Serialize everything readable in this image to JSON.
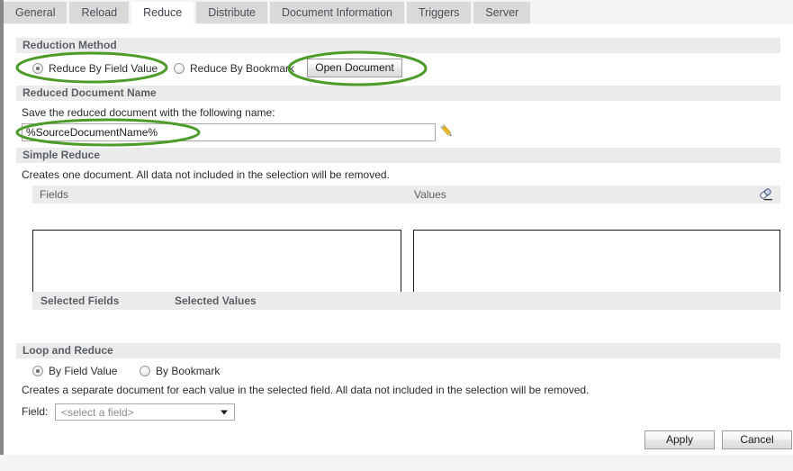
{
  "tabs": [
    {
      "label": "General",
      "active": false
    },
    {
      "label": "Reload",
      "active": false
    },
    {
      "label": "Reduce",
      "active": true
    },
    {
      "label": "Distribute",
      "active": false
    },
    {
      "label": "Document Information",
      "active": false
    },
    {
      "label": "Triggers",
      "active": false
    },
    {
      "label": "Server",
      "active": false
    }
  ],
  "reduction_method": {
    "section_title": "Reduction Method",
    "radio_field_value": "Reduce By Field Value",
    "radio_bookmark": "Reduce By Bookmark",
    "open_document_button": "Open Document"
  },
  "reduced_document_name": {
    "section_title": "Reduced Document Name",
    "description": "Save the reduced document with the following name:",
    "name_value": "%SourceDocumentName%",
    "name_placeholder": "",
    "edit_icon": "pencil-icon"
  },
  "simple_reduce": {
    "section_title": "Simple Reduce",
    "description": "Creates one document. All data not included in the selection will be removed.",
    "fields_header": "Fields",
    "values_header": "Values",
    "clear_icon": "eraser-icon",
    "fields_items": [],
    "values_items": [],
    "selected_fields_header": "Selected Fields",
    "selected_values_header": "Selected Values",
    "selected_rows": []
  },
  "loop_and_reduce": {
    "section_title": "Loop and Reduce",
    "radio_field_value": "By Field Value",
    "radio_bookmark": "By Bookmark",
    "description": "Creates a separate document for each value in the selected field. All data not included in the selection will be removed.",
    "field_label": "Field:",
    "field_select_value": "<select a field>"
  },
  "footer": {
    "apply_button": "Apply",
    "cancel_button": "Cancel"
  },
  "annotations": {
    "color": "#4d9b28",
    "stroke_width": 3,
    "shapes": [
      "ellipse-reduce-by-field-value",
      "ellipse-open-document",
      "ellipse-source-document-name"
    ]
  }
}
